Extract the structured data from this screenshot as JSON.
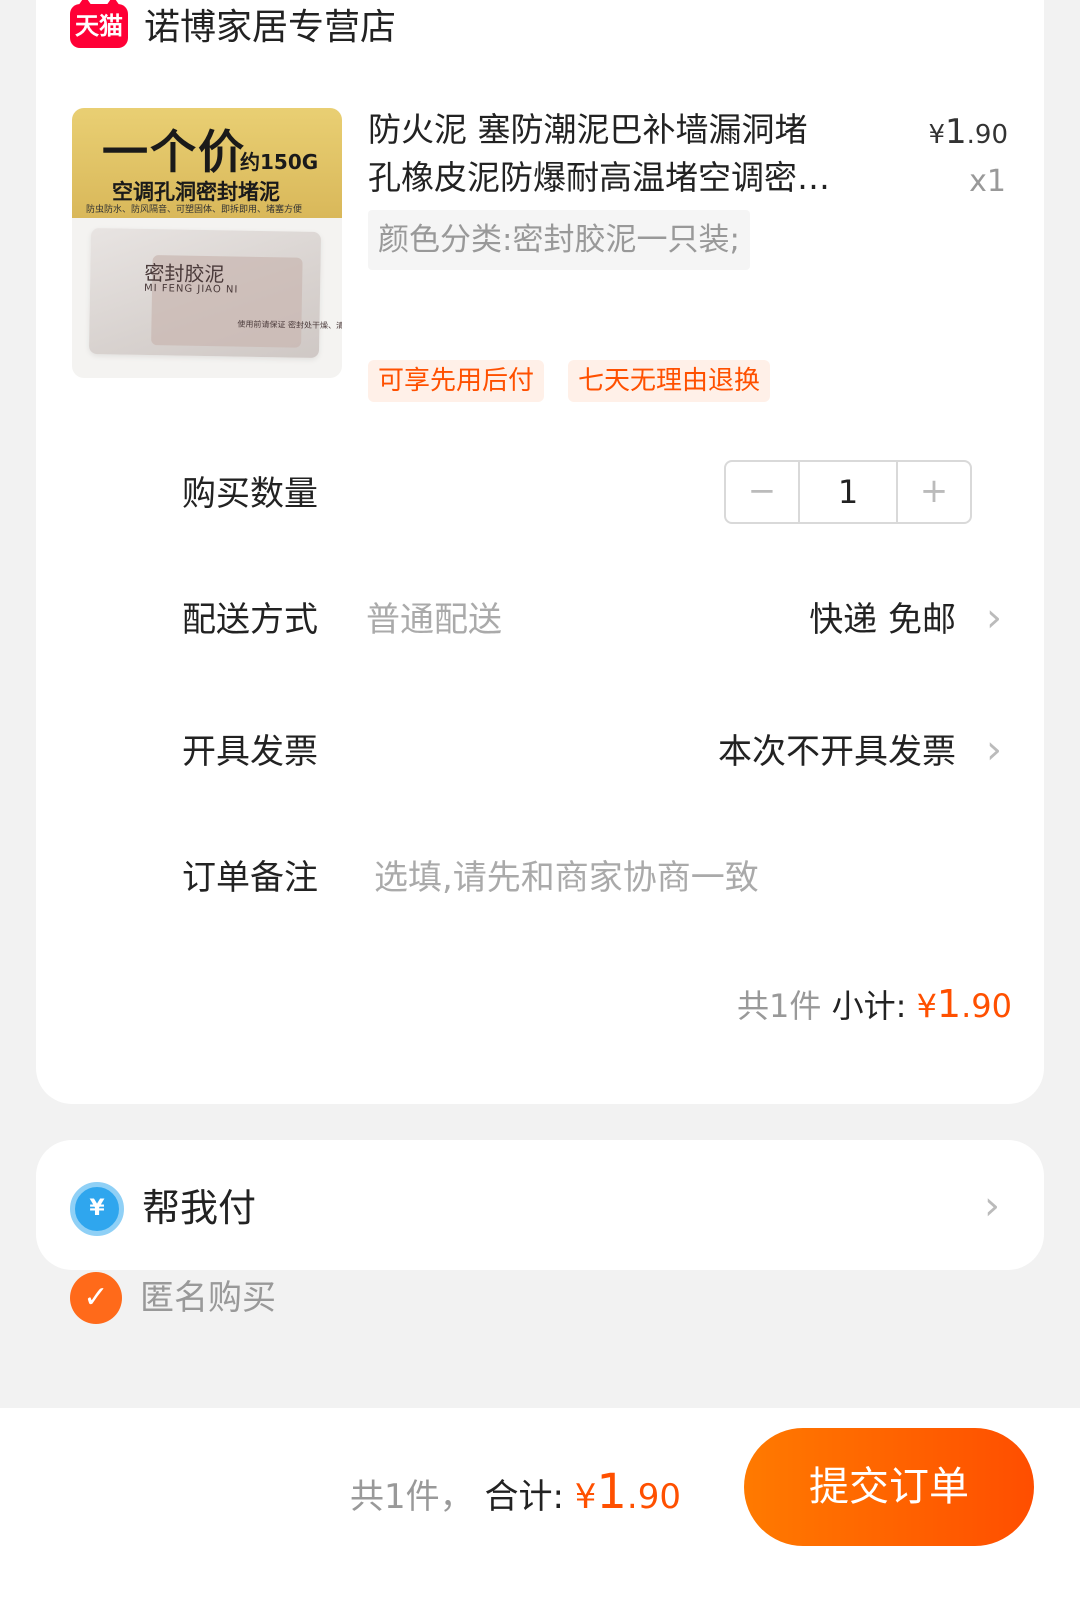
{
  "store": {
    "badge_label": "天猫",
    "name": "诺博家居专营店"
  },
  "product": {
    "image": {
      "banner_main": "一个价",
      "banner_weight": "约150G",
      "banner_sub": "空调孔洞密封堵泥",
      "banner_features": "防虫防水、防风隔音、可塑固体、即拆即用、堵塞方便",
      "package_title": "密封胶泥",
      "package_pinyin": "MI  FENG  JIAO  NI",
      "package_note": "使用前请保证 密封处干燥、清洁"
    },
    "title_line1": "防火泥 塞防潮泥巴补墙漏洞堵",
    "title_line2": "孔橡皮泥防爆耐高温堵空调密…",
    "price_currency": "¥",
    "price_int": "1",
    "price_dec": ".90",
    "quantity_label": "x1",
    "sku": "颜色分类:密封胶泥一只装;",
    "tags": [
      "可享先用后付",
      "七天无理由退换"
    ]
  },
  "order": {
    "quantity": {
      "label": "购买数量",
      "minus": "−",
      "value": "1",
      "plus": "+"
    },
    "delivery": {
      "label": "配送方式",
      "method": "普通配送",
      "value": "快递 免邮"
    },
    "invoice": {
      "label": "开具发票",
      "value": "本次不开具发票"
    },
    "note": {
      "label": "订单备注",
      "placeholder": "选填,请先和商家协商一致"
    },
    "subtotal": {
      "count_text": "共1件",
      "label": "小计:",
      "currency": "¥",
      "int": "1",
      "dec": ".90"
    }
  },
  "pay_for_me": {
    "icon_glyph": "¥",
    "label": "帮我付"
  },
  "anonymous": {
    "label": "匿名购买",
    "checked": true
  },
  "footer": {
    "count_text": "共1件，",
    "total_label": "合计:",
    "currency": "¥",
    "int": "1",
    "dec": ".90",
    "submit_label": "提交订单"
  },
  "colors": {
    "accent": "#ff5000",
    "tmall_red": "#ff0036",
    "pay_blue": "#2fa6ee"
  }
}
